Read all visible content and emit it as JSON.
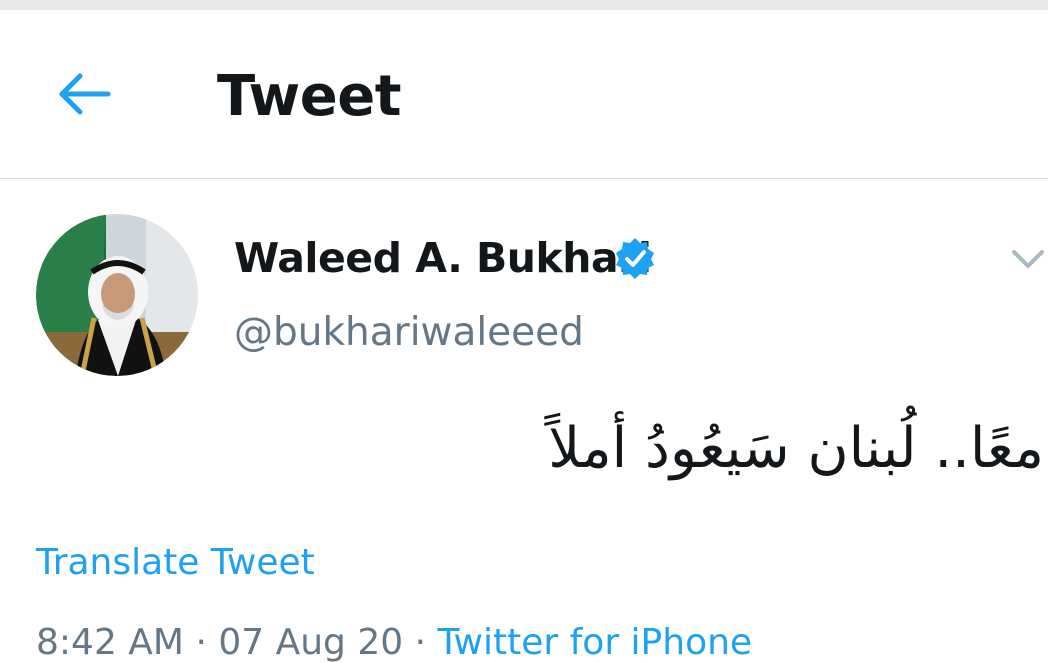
{
  "header": {
    "title": "Tweet",
    "back_icon": "arrow-left-icon"
  },
  "tweet": {
    "author": {
      "display_name": "Waleed A. Bukhari",
      "handle": "@bukhariwaleeed",
      "verified": true,
      "verified_icon": "verified-badge-icon"
    },
    "text": "معًا.. لُبنان سَيعُودُ أملاً",
    "translate_label": "Translate Tweet",
    "meta": {
      "time": "8:42 AM",
      "separator": "·",
      "date": "07 Aug 20",
      "source": "Twitter for iPhone"
    },
    "menu_icon": "chevron-down-icon"
  },
  "colors": {
    "accent": "#1da1f2",
    "text_primary": "#14171a",
    "text_secondary": "#657786",
    "divider": "#d8dce0"
  }
}
